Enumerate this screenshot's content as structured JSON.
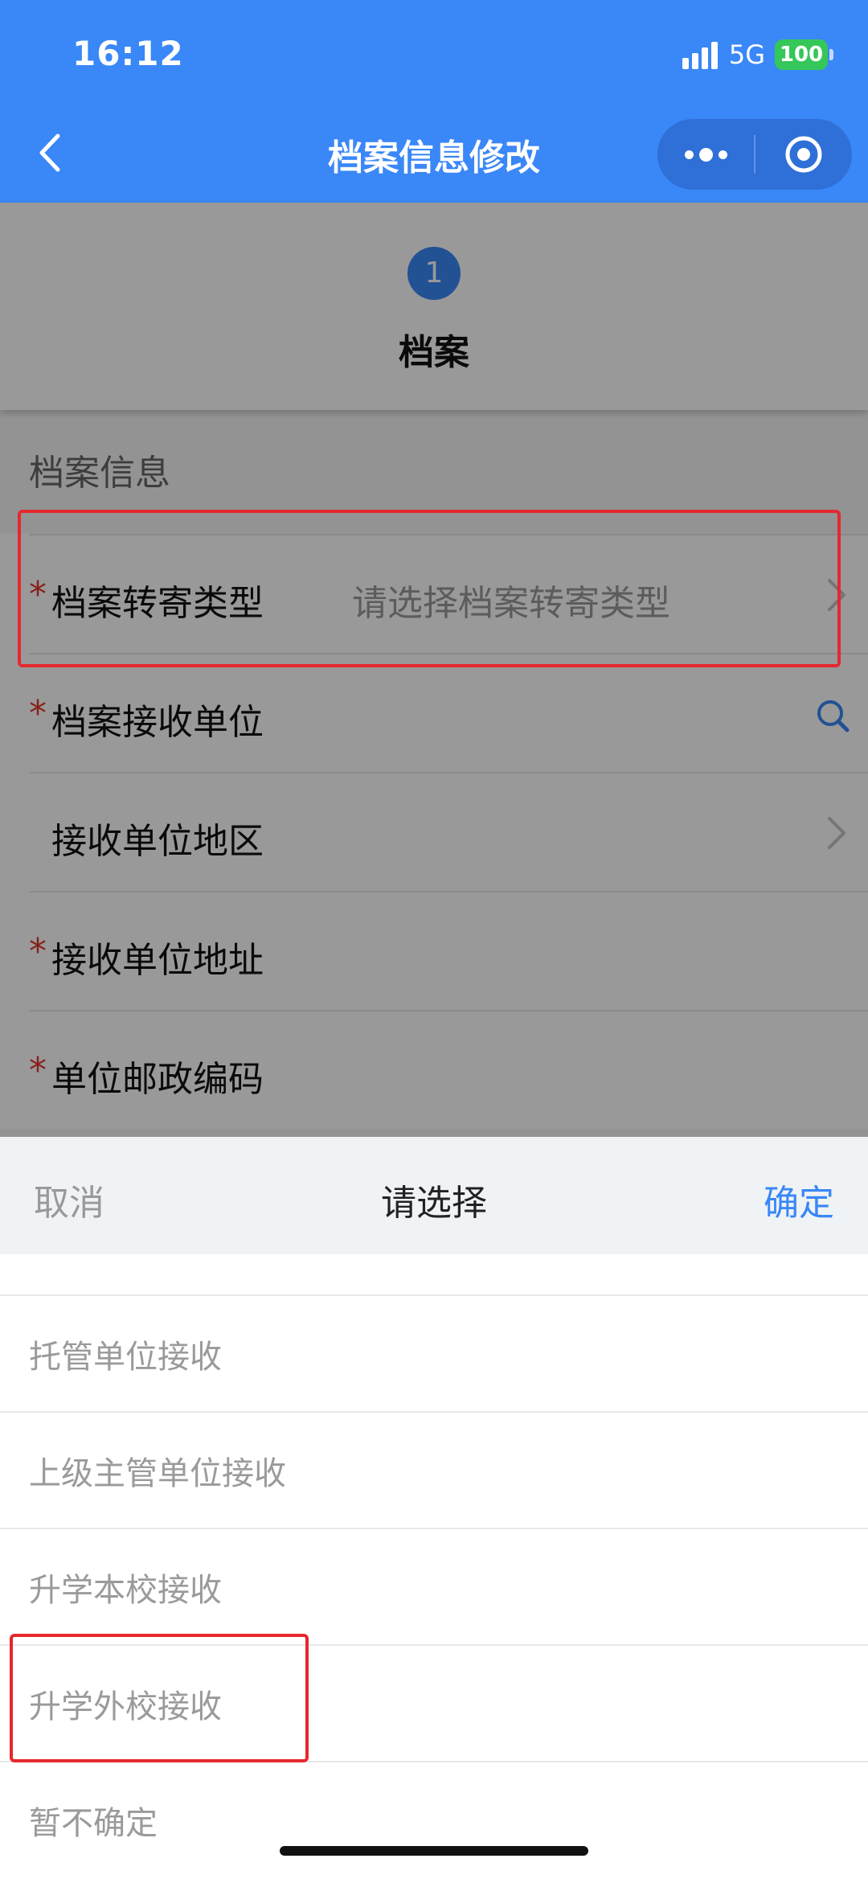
{
  "status_bar": {
    "time": "16:12",
    "network": "5G",
    "battery": "100"
  },
  "navbar": {
    "title": "档案信息修改",
    "back_icon": "chevron-left-icon",
    "menu_icon": "more-dots-icon",
    "close_icon": "target-icon"
  },
  "steps": {
    "number": "1",
    "label": "档案"
  },
  "section": {
    "title": "档案信息"
  },
  "form": {
    "rows": [
      {
        "label": "档案转寄类型",
        "required": "*",
        "value": "请选择档案转寄类型",
        "icon": "chevron-right-icon"
      },
      {
        "label": "档案接收单位",
        "required": "*",
        "value": "",
        "icon": "search-icon"
      },
      {
        "label": "接收单位地区",
        "required": "",
        "value": "",
        "icon": "chevron-right-icon"
      },
      {
        "label": "接收单位地址",
        "required": "*",
        "value": ""
      },
      {
        "label": "单位邮政编码",
        "required": "*",
        "value": ""
      }
    ]
  },
  "picker": {
    "cancel": "取消",
    "title": "请选择",
    "confirm": "确定",
    "options": [
      "托管单位接收",
      "上级主管单位接收",
      "升学本校接收",
      "升学外校接收",
      "暂不确定"
    ]
  },
  "colors": {
    "accent": "#3a87f7",
    "highlight": "#e5282e",
    "required": "#e23a2e"
  }
}
